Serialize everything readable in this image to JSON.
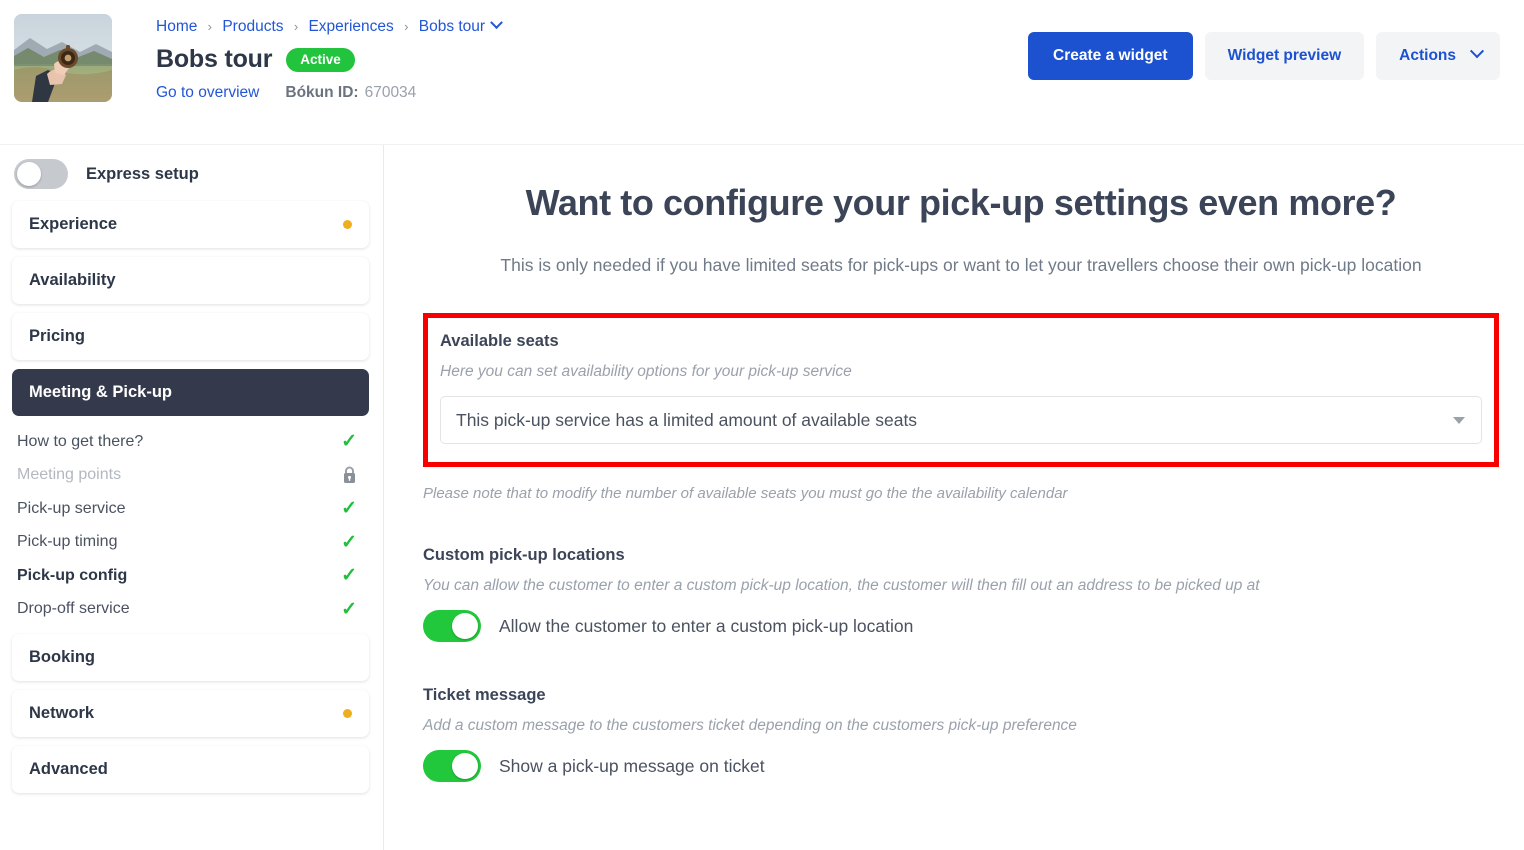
{
  "header": {
    "thumbnail_alt": "hand holding compass in mountain landscape",
    "breadcrumb": {
      "home": "Home",
      "products": "Products",
      "experiences": "Experiences",
      "current": "Bobs tour",
      "separator": "›"
    },
    "product_title": "Bobs tour",
    "status_badge": "Active",
    "overview_link": "Go to overview",
    "bokun_id_label": "Bókun ID:",
    "bokun_id_value": "670034",
    "buttons": {
      "create_widget": "Create a widget",
      "widget_preview": "Widget preview",
      "actions": "Actions"
    },
    "accent_blue": "#1c51cf",
    "badge_green": "#21c43c"
  },
  "sidebar": {
    "express_setup_label": "Express setup",
    "express_setup_on": false,
    "nav": [
      {
        "label": "Experience",
        "active": false,
        "dot": true
      },
      {
        "label": "Availability",
        "active": false,
        "dot": false
      },
      {
        "label": "Pricing",
        "active": false,
        "dot": false
      },
      {
        "label": "Meeting & Pick-up",
        "active": true,
        "dot": false
      }
    ],
    "sub_items": [
      {
        "label": "How to get there?",
        "state": "check",
        "bold": false
      },
      {
        "label": "Meeting points",
        "state": "lock",
        "bold": false
      },
      {
        "label": "Pick-up service",
        "state": "check",
        "bold": false
      },
      {
        "label": "Pick-up timing",
        "state": "check",
        "bold": false
      },
      {
        "label": "Pick-up config",
        "state": "check",
        "bold": true
      },
      {
        "label": "Drop-off service",
        "state": "check",
        "bold": false
      }
    ],
    "nav_bottom": [
      {
        "label": "Booking",
        "active": false,
        "dot": false
      },
      {
        "label": "Network",
        "active": false,
        "dot": true
      },
      {
        "label": "Advanced",
        "active": false,
        "dot": false
      }
    ],
    "check_color": "#1fbf3c",
    "dot_color": "#f0ad20",
    "active_bg": "#343a4b"
  },
  "main": {
    "title": "Want to configure your pick-up settings even more?",
    "subtitle": "This is only needed if you have limited seats for pick-ups or want to let your travellers choose their own pick-up location",
    "available_seats": {
      "title": "Available seats",
      "description": "Here you can set availability options for your pick-up service",
      "selected_option": "This pick-up service has a limited amount of available seats",
      "note": "Please note that to modify the number of available seats you must go the the availability calendar",
      "highlight_color": "#f80000"
    },
    "custom_locations": {
      "title": "Custom pick-up locations",
      "description": "You can allow the customer to enter a custom pick-up location, the customer will then fill out an address to be picked up at",
      "toggle_label": "Allow the customer to enter a custom pick-up location",
      "toggle_on": true
    },
    "ticket_message": {
      "title": "Ticket message",
      "description": "Add a custom message to the customers ticket depending on the customers pick-up preference",
      "toggle_label": "Show a pick-up message on ticket",
      "toggle_on": true
    },
    "toggle_on_color": "#22c83c"
  }
}
